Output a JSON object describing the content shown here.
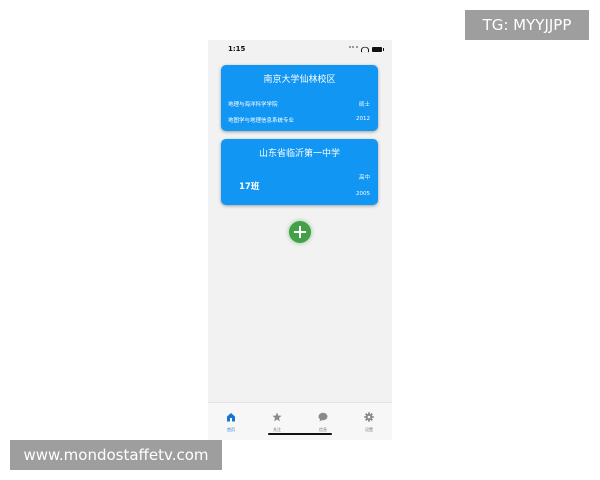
{
  "watermarks": {
    "top_right": "TG: MYYJJPP",
    "bottom_left": "www.mondostaffetv.com"
  },
  "status_bar": {
    "time": "1:15"
  },
  "cards": [
    {
      "title": "南京大学仙林校区",
      "college": "地理与海洋科学学院",
      "degree": "硕士",
      "major": "地图学与地理信息系统专业",
      "year": "2012"
    },
    {
      "title": "山东省临沂第一中学",
      "class_name": "17班",
      "degree": "高中",
      "year": "2005"
    }
  ],
  "add_button": {
    "icon": "plus-icon"
  },
  "tab_bar": {
    "items": [
      {
        "label": "首页",
        "icon": "home-icon",
        "active": true
      },
      {
        "label": "关注",
        "icon": "star-icon",
        "active": false
      },
      {
        "label": "信息",
        "icon": "message-icon",
        "active": false
      },
      {
        "label": "设置",
        "icon": "gear-icon",
        "active": false
      }
    ]
  },
  "colors": {
    "card_blue": "#1296f3",
    "add_green": "#43a047",
    "tab_active": "#1676d2",
    "tab_inactive": "#8a8a8a"
  }
}
